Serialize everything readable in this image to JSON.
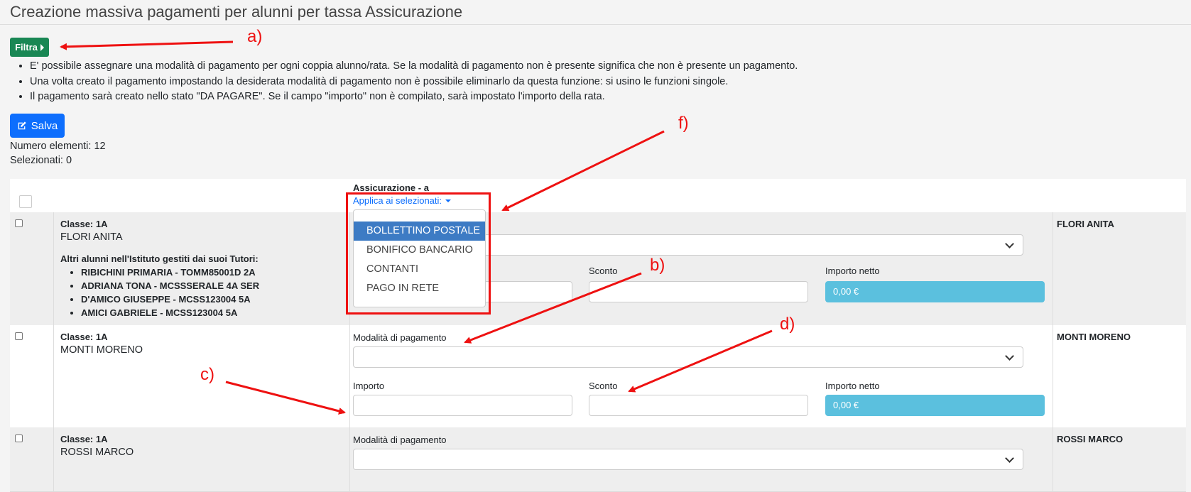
{
  "page": {
    "title": "Creazione massiva pagamenti per alunni per tassa Assicurazione"
  },
  "filter_button": {
    "label": "Filtra"
  },
  "notes": [
    "E' possibile assegnare una modalità di pagamento per ogni coppia alunno/rata. Se la modalità di pagamento non è presente significa che non è presente un pagamento.",
    "Una volta creato il pagamento impostando la desiderata modalità di pagamento non è possibile eliminarlo da questa funzione: si usino le funzioni singole.",
    "Il pagamento sarà creato nello stato \"DA PAGARE\". Se il campo \"importo\" non è compilato, sarà impostato l'importo della rata."
  ],
  "save_button": {
    "label": "Salva"
  },
  "counts": {
    "elements": "Numero elementi: 12",
    "selected": "Selezionati: 0"
  },
  "table_header": {
    "column_title": "Assicurazione - a",
    "apply_selected": "Applica ai selezionati:"
  },
  "labels": {
    "payment_mode": "Modalità di pagamento",
    "amount": "Importo",
    "discount": "Sconto",
    "net_amount": "Importo netto",
    "other_students": "Altri alunni nell'Istituto gestiti dai suoi Tutori:"
  },
  "dropdown_options": [
    "BOLLETTINO POSTALE",
    "BONIFICO BANCARIO",
    "CONTANTI",
    "PAGO IN RETE"
  ],
  "rows": [
    {
      "classe": "Classe: 1A",
      "student": "FLORI ANITA",
      "other_students": [
        "RIBICHINI PRIMARIA - TOMM85001D 2A",
        "ADRIANA TONA - MCSSSERALE 4A SER",
        "D'AMICO GIUSEPPE - MCSS123004 5A",
        "AMICI GABRIELE - MCSS123004 5A"
      ],
      "net_value": "0,00 €",
      "right_name": "FLORI ANITA"
    },
    {
      "classe": "Classe: 1A",
      "student": "MONTI MORENO",
      "net_value": "0,00 €",
      "right_name": "MONTI MORENO"
    },
    {
      "classe": "Classe: 1A",
      "student": "ROSSI MARCO",
      "right_name": "ROSSI MARCO"
    }
  ],
  "callouts": {
    "a": "a)",
    "b": "b)",
    "c": "c)",
    "d": "d)",
    "f": "f)"
  },
  "colors": {
    "annotation": "#e11111",
    "primary": "#0d6efd",
    "success": "#198754",
    "info": "#5bc0de"
  }
}
